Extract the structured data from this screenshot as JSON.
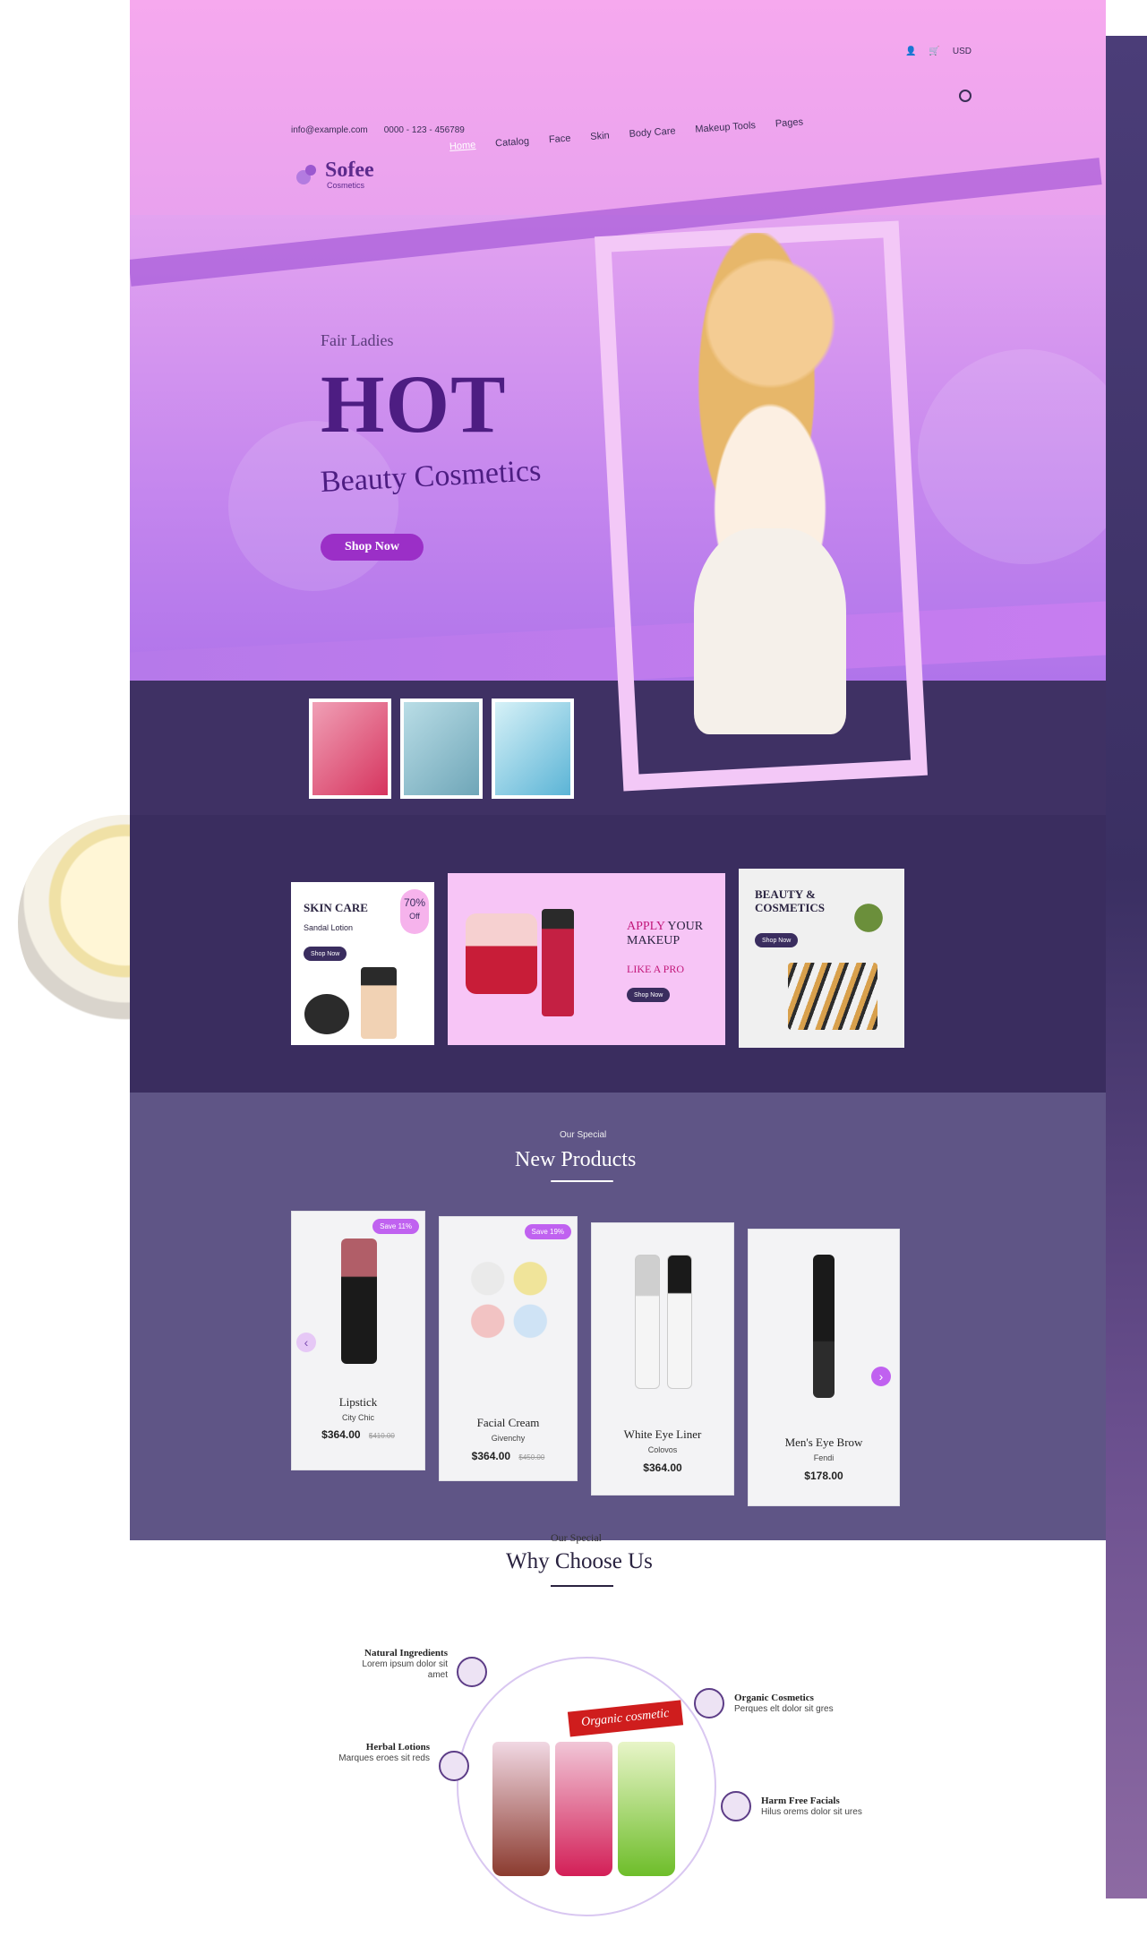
{
  "header": {
    "email": "info@example.com",
    "phone": "0000 - 123 - 456789",
    "currency": "USD",
    "logo_name": "Sofee",
    "logo_sub": "Cosmetics",
    "nav": [
      "Home",
      "Catalog",
      "Face",
      "Skin",
      "Body Care",
      "Makeup Tools",
      "Pages"
    ]
  },
  "hero": {
    "kicker": "Fair Ladies",
    "headline": "HOT",
    "subheadline": "Beauty Cosmetics",
    "cta": "Shop Now"
  },
  "promos": [
    {
      "title": "SKIN CARE",
      "subtitle": "Sandal Lotion",
      "badge": "70%",
      "badge_sub": "Off",
      "cta": "Shop Now"
    },
    {
      "line1": "APPLY",
      "line1b": "YOUR",
      "line2": "MAKEUP",
      "line3": "LIKE A PRO",
      "cta": "Shop Now"
    },
    {
      "title": "BEAUTY &",
      "title2": "COSMETICS",
      "cta": "Shop Now"
    }
  ],
  "new_products": {
    "kicker": "Our Special",
    "title": "New Products",
    "items": [
      {
        "name": "Lipstick",
        "brand": "City Chic",
        "price": "$364.00",
        "old": "$410.00",
        "badge": "Save 11%"
      },
      {
        "name": "Facial Cream",
        "brand": "Givenchy",
        "price": "$364.00",
        "old": "$450.00",
        "badge": "Save 19%"
      },
      {
        "name": "White Eye Liner",
        "brand": "Colovos",
        "price": "$364.00",
        "old": "",
        "badge": ""
      },
      {
        "name": "Men's Eye Brow",
        "brand": "Fendi",
        "price": "$178.00",
        "old": "",
        "badge": ""
      }
    ]
  },
  "why": {
    "kicker": "Our Special",
    "title": "Why Choose Us",
    "ribbon": "Organic cosmetic",
    "features": [
      {
        "title": "Natural Ingredients",
        "desc": "Lorem ipsum dolor sit amet"
      },
      {
        "title": "Herbal Lotions",
        "desc": "Marques eroes sit reds"
      },
      {
        "title": "Organic Cosmetics",
        "desc": "Perques elt dolor sit gres"
      },
      {
        "title": "Harm Free Facials",
        "desc": "Hilus orems dolor sit ures"
      }
    ]
  }
}
